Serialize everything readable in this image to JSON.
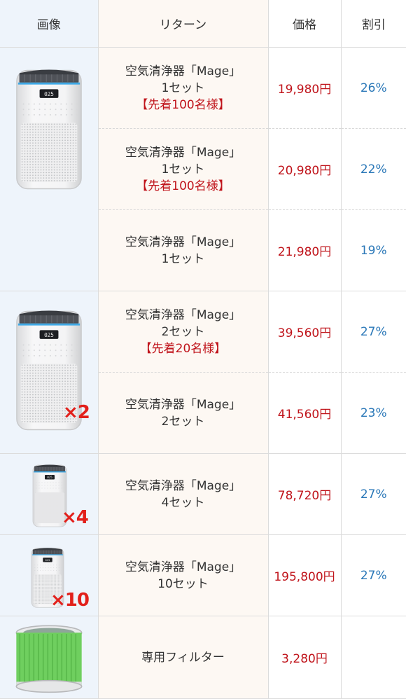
{
  "header": {
    "image": "画像",
    "return": "リターン",
    "price": "価格",
    "discount": "割引"
  },
  "rows": [
    {
      "name": "空気清浄器「Mage」",
      "sets": "1セット",
      "note": "【先着100名様】",
      "price": "19,980円",
      "discount": "26%"
    },
    {
      "name": "空気清浄器「Mage」",
      "sets": "1セット",
      "note": "【先着100名様】",
      "price": "20,980円",
      "discount": "22%"
    },
    {
      "name": "空気清浄器「Mage」",
      "sets": "1セット",
      "note": "",
      "price": "21,980円",
      "discount": "19%"
    },
    {
      "name": "空気清浄器「Mage」",
      "sets": "2セット",
      "note": "【先着20名様】",
      "price": "39,560円",
      "discount": "27%"
    },
    {
      "name": "空気清浄器「Mage」",
      "sets": "2セット",
      "note": "",
      "price": "41,560円",
      "discount": "23%"
    },
    {
      "name": "空気清浄器「Mage」",
      "sets": "4セット",
      "note": "",
      "price": "78,720円",
      "discount": "27%"
    },
    {
      "name": "空気清浄器「Mage」",
      "sets": "10セット",
      "note": "",
      "price": "195,800円",
      "discount": "27%"
    },
    {
      "name": "専用フィルター",
      "sets": "",
      "note": "",
      "price": "3,280円",
      "discount": ""
    }
  ],
  "multipliers": {
    "x2": "×2",
    "x4": "×4",
    "x10": "×10"
  },
  "colors": {
    "price": "#c0141b",
    "discount": "#2b78b8",
    "note": "#c0141b",
    "multiplier": "#e2201b"
  }
}
